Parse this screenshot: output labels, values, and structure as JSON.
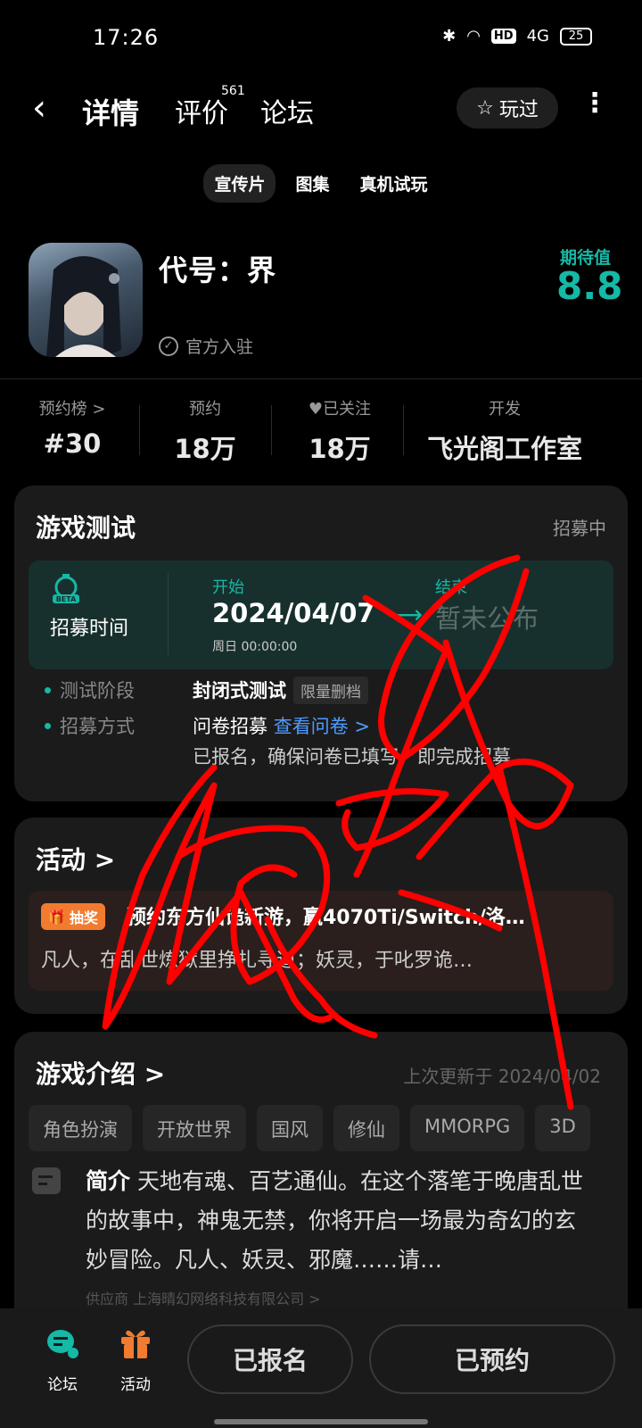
{
  "status_bar": {
    "time": "17:26",
    "hd": "HD",
    "network": "4G",
    "battery": "25"
  },
  "nav": {
    "tab_detail": "详情",
    "tab_reviews": "评价",
    "reviews_count": "561",
    "tab_forum": "论坛",
    "played_label": "玩过"
  },
  "media_tabs": [
    "宣传片",
    "图集",
    "真机试玩"
  ],
  "game": {
    "title": "代号：界",
    "official": "官方入驻",
    "expect_label": "期待值",
    "expect_score": "8.8"
  },
  "stats": [
    {
      "label": "预约榜 >",
      "value": "#30"
    },
    {
      "label": "预约",
      "value": "18万"
    },
    {
      "label": "已关注",
      "value": "18万"
    },
    {
      "label": "开发",
      "value": "飞光阁工作室"
    }
  ],
  "test": {
    "title": "游戏测试",
    "status": "招募中",
    "recruit_label": "招募时间",
    "start_label": "开始",
    "start_date": "2024/04/07",
    "start_time": "周日  00:00:00",
    "end_label": "结束",
    "end_value": "暂未公布",
    "phase_label": "测试阶段",
    "phase_value": "封闭式测试",
    "phase_tag": "限量删档",
    "method_label": "招募方式",
    "method_value": "问卷招募",
    "method_link": "查看问卷 >",
    "method_note": "已报名，确保问卷已填写，即完成招募"
  },
  "activity": {
    "title": "活动 >",
    "badge": "抽奖",
    "headline": "预约东方仙诡新游，赢4070Ti/Switch/洛…",
    "desc": "凡人，在乱世炼狱里挣扎寻道；妖灵，于叱罗诡…"
  },
  "intro": {
    "title": "游戏介绍 >",
    "updated": "上次更新于 2024/04/02",
    "genres": [
      "角色扮演",
      "开放世界",
      "国风",
      "修仙",
      "MMORPG",
      "3D"
    ],
    "label": "简介",
    "text": "天地有魂、百艺通仙。在这个落笔于晚唐乱世的故事中，神鬼无禁，你将开启一场最为奇幻的玄妙冒险。凡人、妖灵、邪魔……请…",
    "supplier": "供应商 上海晴幻网络科技有限公司 >"
  },
  "bottom": {
    "forum": "论坛",
    "activity": "活动",
    "signed_up": "已报名",
    "reserved": "已预约"
  },
  "colors": {
    "accent": "#16b8a6",
    "link": "#4f9bff",
    "lottery": "#f27b2f",
    "scribble": "#ff0000"
  }
}
